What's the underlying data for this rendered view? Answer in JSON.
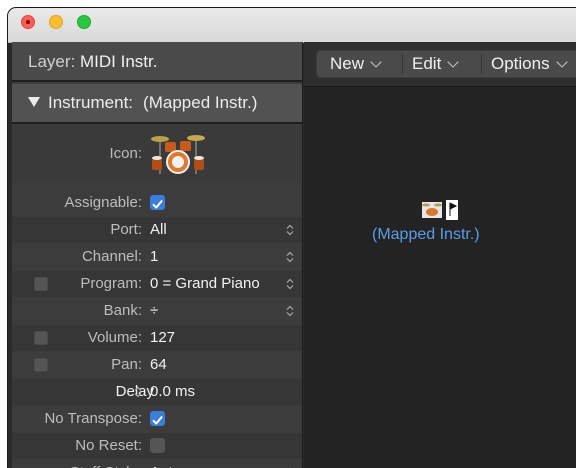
{
  "window": {
    "traffic_lights": {
      "close_color": "#fe5f57",
      "minimize_color": "#febc2e",
      "zoom_color": "#28c840"
    }
  },
  "inspector": {
    "layer_label": "Layer:",
    "layer_value": "MIDI Instr.",
    "section_label": "Instrument:",
    "section_value": "(Mapped Instr.)",
    "icon_label": "Icon:",
    "icon_name": "drum-kit-icon",
    "params": {
      "assignable": {
        "label": "Assignable:",
        "checked": true
      },
      "port": {
        "label": "Port:",
        "value": "All"
      },
      "channel": {
        "label": "Channel:",
        "value": "1"
      },
      "program": {
        "label": "Program:",
        "value": "0 = Grand Piano",
        "enabled": false
      },
      "bank": {
        "label": "Bank:",
        "value": "÷"
      },
      "volume": {
        "label": "Volume:",
        "value": "127",
        "enabled": false
      },
      "pan": {
        "label": "Pan:",
        "value": "64",
        "enabled": false
      },
      "delay": {
        "label": "Delay",
        "value": "0.0 ms"
      },
      "no_transpose": {
        "label": "No Transpose:",
        "checked": true
      },
      "no_reset": {
        "label": "No Reset:",
        "checked": false
      },
      "staff_style": {
        "label": "Staff Style:",
        "value": "Auto"
      }
    }
  },
  "toolbar": {
    "new_label": "New",
    "edit_label": "Edit",
    "options_label": "Options"
  },
  "environment": {
    "object_label": "(Mapped Instr.)"
  },
  "colors": {
    "accent": "#3b7ddb",
    "link_blue": "#5a9de8"
  }
}
